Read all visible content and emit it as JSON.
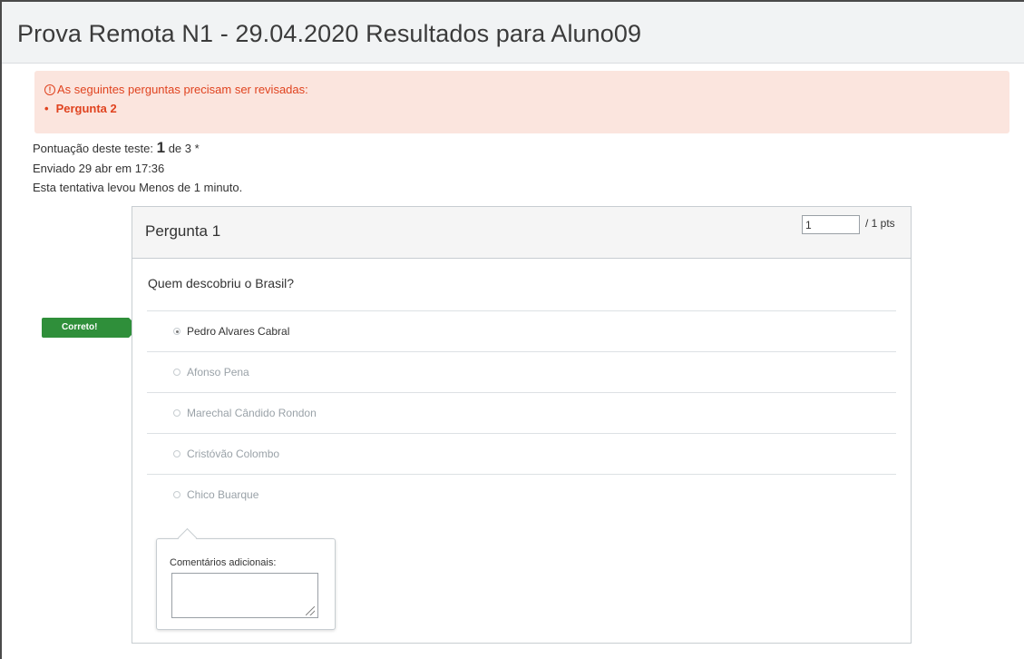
{
  "header": {
    "title": "Prova Remota N1 - 29.04.2020 Resultados para Aluno09"
  },
  "alert": {
    "icon": "exclamation-circle-icon",
    "icon_glyph": "!",
    "message": "As seguintes perguntas precisam ser revisadas:",
    "items": [
      "Pergunta 2"
    ]
  },
  "summary": {
    "score_label": "Pontuação deste teste:",
    "score_value": "1",
    "score_total": "de 3 *",
    "submitted": "Enviado 29 abr em 17:36",
    "duration": "Esta tentativa levou Menos de 1 minuto."
  },
  "question": {
    "title": "Pergunta 1",
    "points_value": "1",
    "points_label": "/ 1 pts",
    "text": "Quem descobriu o Brasil?",
    "correct_label": "Correto!",
    "answers": [
      {
        "label": "Pedro Alvares Cabral",
        "selected": true
      },
      {
        "label": "Afonso Pena",
        "selected": false
      },
      {
        "label": "Marechal Cândido Rondon",
        "selected": false
      },
      {
        "label": "Cristóvão Colombo",
        "selected": false
      },
      {
        "label": "Chico Buarque",
        "selected": false
      }
    ],
    "comments_label": "Comentários adicionais:",
    "comments_value": ""
  }
}
